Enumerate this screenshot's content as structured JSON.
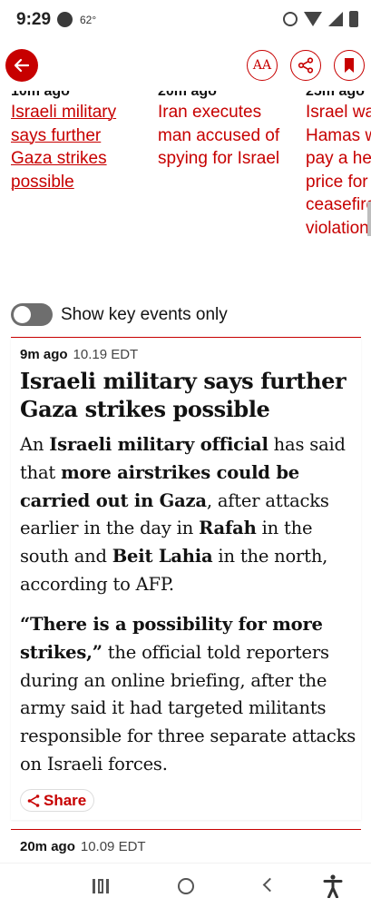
{
  "status_bar": {
    "time": "9:29",
    "temperature": "62°"
  },
  "toolbar": {
    "font_button_label": "AA"
  },
  "carousel": [
    {
      "time": "10m ago",
      "title": "Israeli military says further Gaza strikes possible"
    },
    {
      "time": "20m ago",
      "title": "Iran executes man accused of spying for Israel"
    },
    {
      "time": "25m ago",
      "title": "Israel warns Hamas will pay a heavy price for any ceasefire violation"
    }
  ],
  "key_events": {
    "label": "Show key events only",
    "enabled": false
  },
  "entry1": {
    "ago": "9m ago",
    "time": "10.19 EDT",
    "title": "Israeli military says further Gaza strikes possible",
    "p1": [
      {
        "t": "An ",
        "b": false
      },
      {
        "t": "Israeli military official",
        "b": true
      },
      {
        "t": " has said that ",
        "b": false
      },
      {
        "t": "more airstrikes could be carried out in Gaza",
        "b": true
      },
      {
        "t": ", after attacks earlier in the day in ",
        "b": false
      },
      {
        "t": "Rafah",
        "b": true
      },
      {
        "t": " in the south and ",
        "b": false
      },
      {
        "t": "Beit Lahia",
        "b": true
      },
      {
        "t": " in the north, according to AFP.",
        "b": false
      }
    ],
    "p2": [
      {
        "t": "“There is a possibility for more strikes,”",
        "b": true
      },
      {
        "t": " the official told reporters during an online briefing, after the army said it had targeted militants responsible for three separate attacks on Israeli forces.",
        "b": false
      }
    ],
    "share_label": "Share"
  },
  "entry2": {
    "ago": "20m ago",
    "time": "10.09 EDT"
  },
  "colors": {
    "accent": "#c70000",
    "text": "#121212"
  }
}
